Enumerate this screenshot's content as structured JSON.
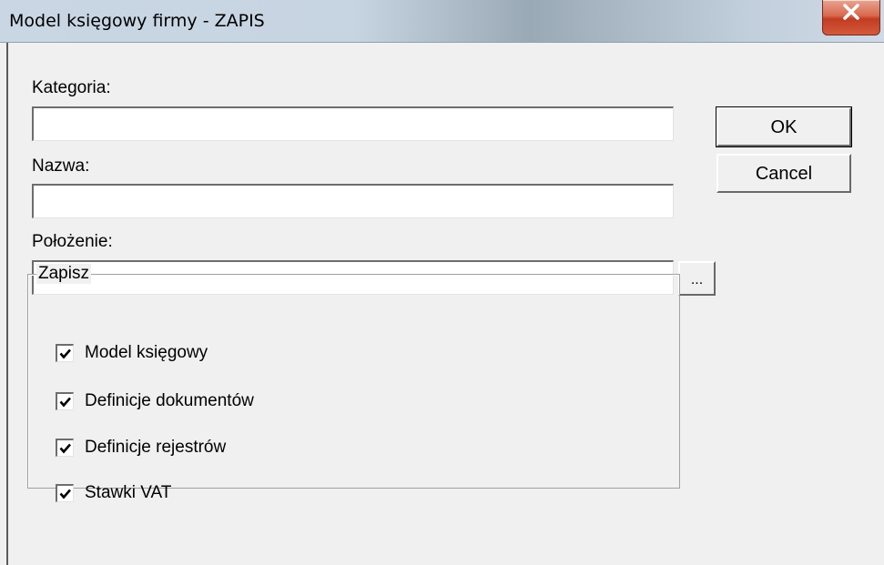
{
  "window": {
    "title": "Model księgowy firmy - ZAPIS",
    "close_glyph": "close-icon"
  },
  "fields": {
    "kategoria": {
      "label": "Kategoria:",
      "value": ""
    },
    "nazwa": {
      "label": "Nazwa:",
      "value": ""
    },
    "polozenie": {
      "label": "Położenie:",
      "value": "",
      "browse_label": "..."
    }
  },
  "buttons": {
    "ok": "OK",
    "cancel": "Cancel"
  },
  "group": {
    "caption": "Zapisz",
    "options": [
      {
        "label": "Model księgowy",
        "checked": true
      },
      {
        "label": "Definicje dokumentów",
        "checked": true
      },
      {
        "label": "Definicje rejestrów",
        "checked": true
      },
      {
        "label": "Stawki VAT",
        "checked": true
      }
    ]
  }
}
